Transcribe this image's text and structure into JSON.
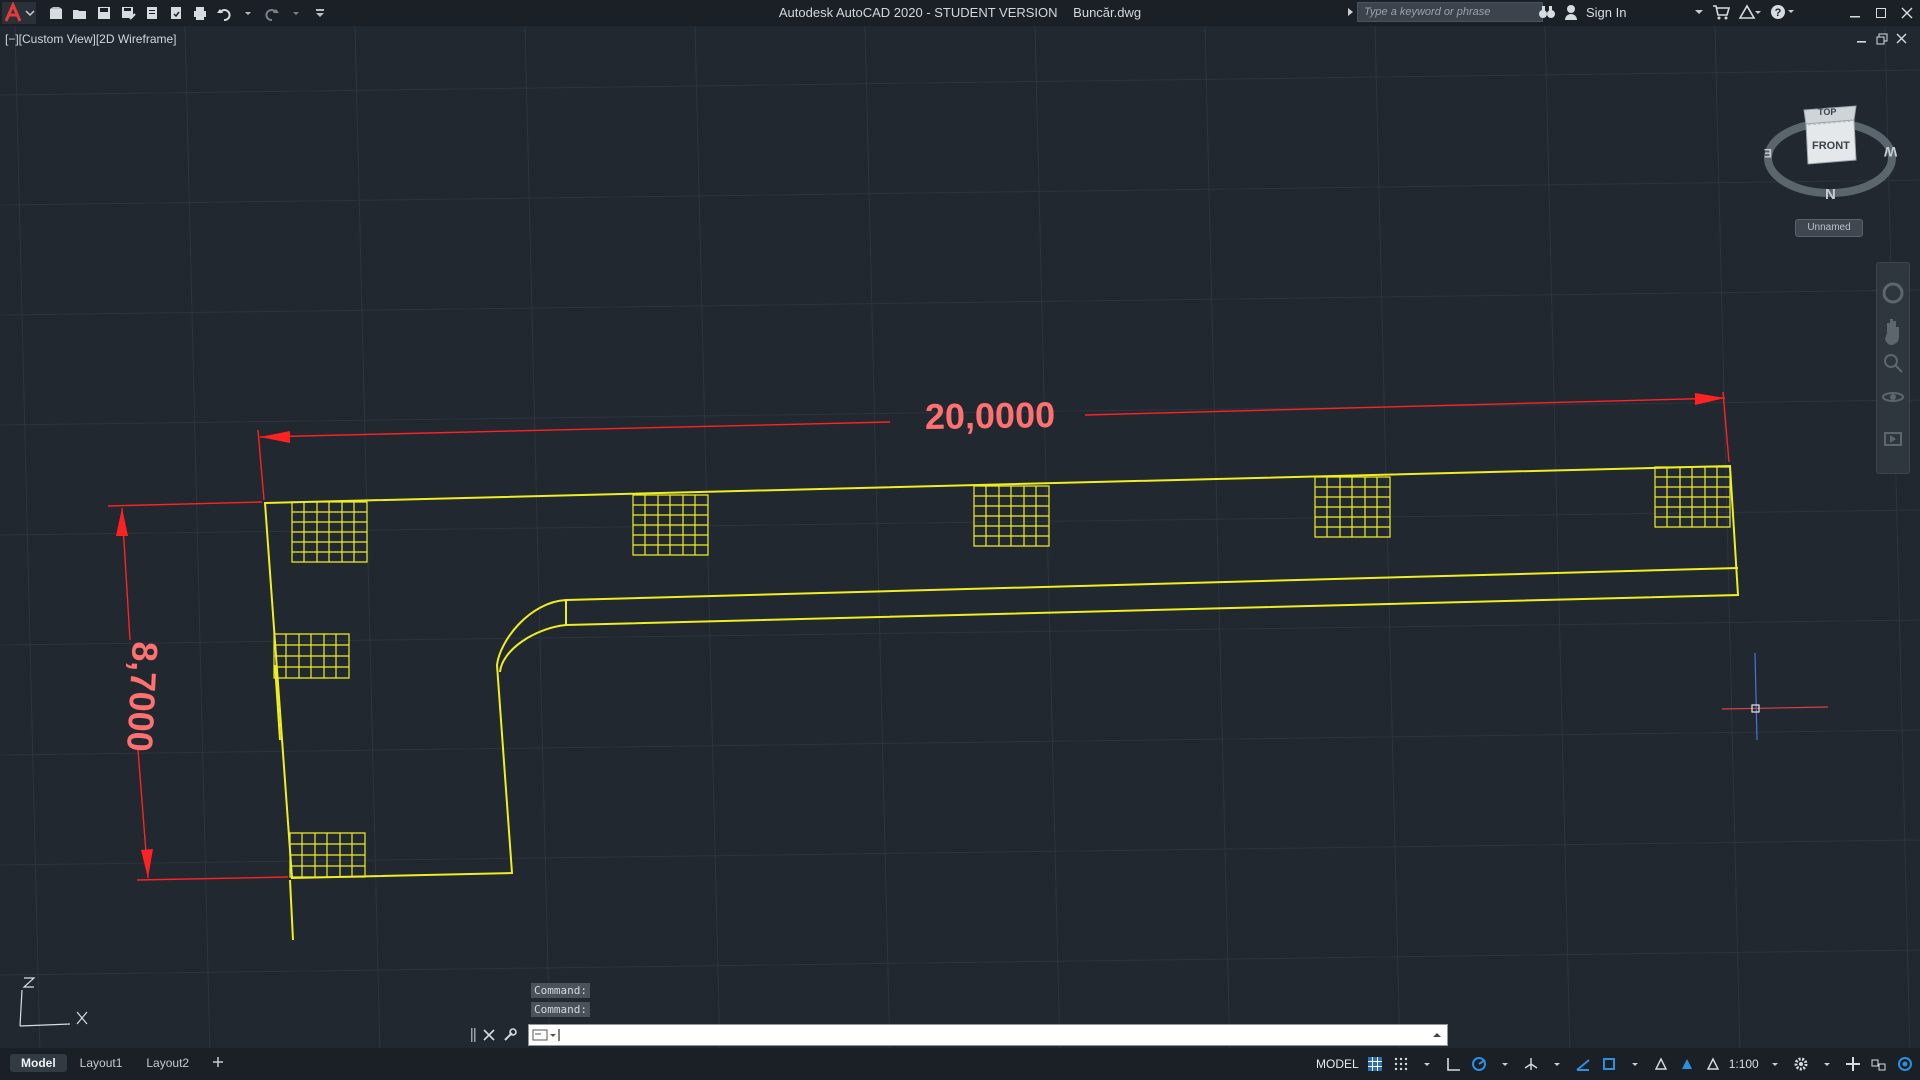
{
  "titlebar": {
    "app_name": "Autodesk AutoCAD 2020 - STUDENT VERSION",
    "file_name": "Buncăr.dwg",
    "search_placeholder": "Type a keyword or phrase",
    "sign_in": "Sign In"
  },
  "viewport": {
    "label": "[−][Custom View][2D Wireframe]",
    "dimension_horizontal": "20,0000",
    "dimension_vertical": "8,7000",
    "viewcube": {
      "top": "TOP",
      "front": "FRONT",
      "north": "N",
      "west": "W",
      "east": "E",
      "view_name": "Unnamed"
    },
    "ucs": {
      "z": "Z",
      "x": "X"
    }
  },
  "command": {
    "history": [
      "Command:",
      "Command:"
    ],
    "input_value": ""
  },
  "tabs": [
    {
      "label": "Model",
      "active": true
    },
    {
      "label": "Layout1",
      "active": false
    },
    {
      "label": "Layout2",
      "active": false
    }
  ],
  "status": {
    "model": "MODEL",
    "scale": "1:100"
  },
  "colors": {
    "background": "#212830",
    "geometry": "#eeee22",
    "dimension": "#ff2222",
    "dimension_text": "#ff7070",
    "grid": "#2c343e"
  }
}
